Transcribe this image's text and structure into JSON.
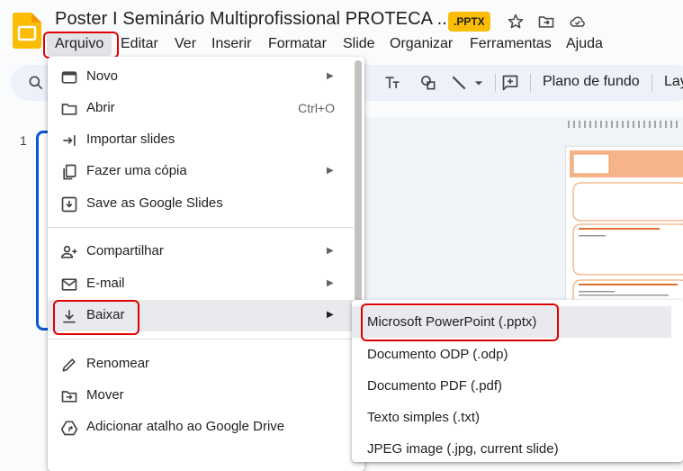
{
  "header": {
    "title": "Poster I Seminário Multiprofissional PROTECA ...",
    "badge": ".PPTX"
  },
  "menubar": {
    "items": [
      "Arquivo",
      "Editar",
      "Ver",
      "Inserir",
      "Formatar",
      "Slide",
      "Organizar",
      "Ferramentas",
      "Ajuda"
    ]
  },
  "toolbar": {
    "background_label": "Plano de fundo",
    "layout_label": "Lay"
  },
  "slides": {
    "number": "1"
  },
  "file_menu": {
    "items": [
      {
        "label": "Novo",
        "icon": "slides-icon"
      },
      {
        "label": "Abrir",
        "icon": "folder-icon",
        "shortcut": "Ctrl+O"
      },
      {
        "label": "Importar slides",
        "icon": "import-icon"
      },
      {
        "label": "Fazer uma cópia",
        "icon": "copy-icon"
      },
      {
        "label": "Save as Google Slides",
        "icon": "save-icon"
      },
      {
        "label": "Compartilhar",
        "icon": "person-add-icon"
      },
      {
        "label": "E-mail",
        "icon": "mail-icon"
      },
      {
        "label": "Baixar",
        "icon": "download-icon"
      },
      {
        "label": "Renomear",
        "icon": "pencil-icon"
      },
      {
        "label": "Mover",
        "icon": "move-folder-icon"
      },
      {
        "label": "Adicionar atalho ao Google Drive",
        "icon": "drive-shortcut-icon"
      }
    ]
  },
  "download_submenu": {
    "items": [
      "Microsoft PowerPoint (.pptx)",
      "Documento ODP (.odp)",
      "Documento PDF (.pdf)",
      "Texto simples (.txt)",
      "JPEG image (.jpg, current slide)"
    ]
  },
  "colors": {
    "accent": "#0b57d0",
    "badge": "#fbbc04",
    "annotation": "#e00000"
  }
}
